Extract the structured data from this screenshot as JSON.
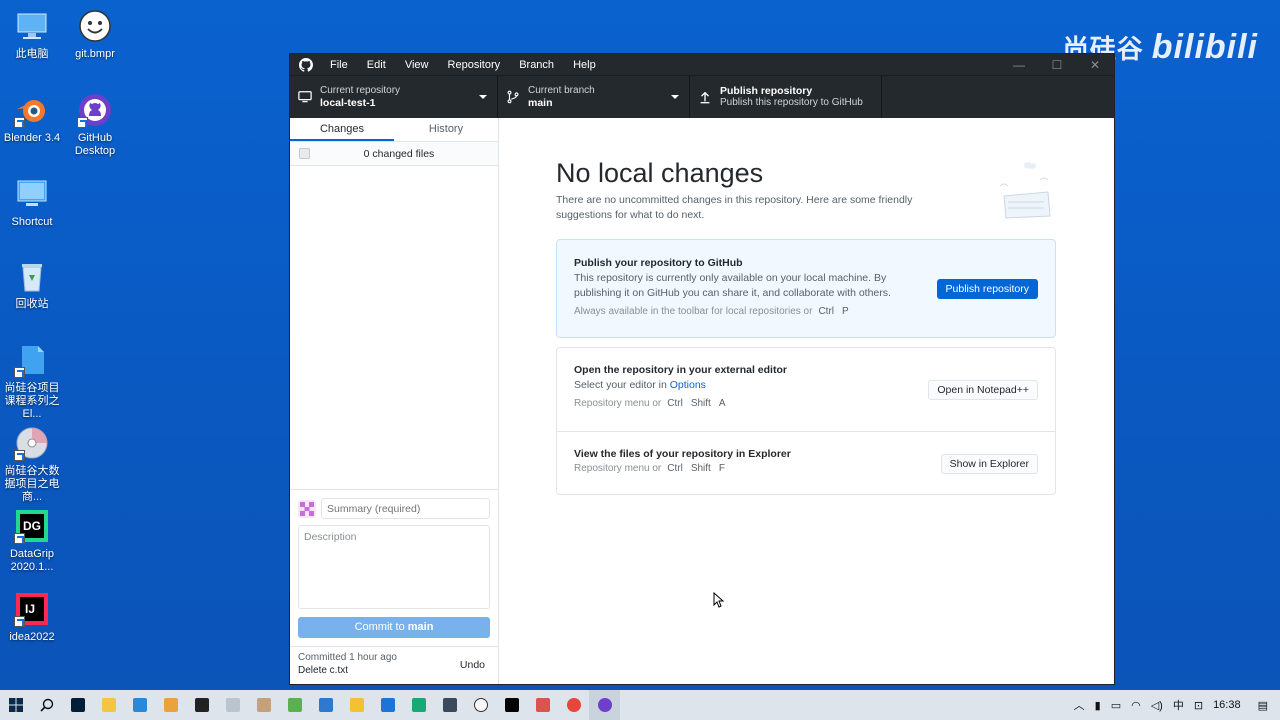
{
  "desktop": {
    "icons": [
      {
        "label": "此电脑"
      },
      {
        "label": "git.bmpr"
      },
      {
        "label": "Blender 3.4"
      },
      {
        "label": "GitHub Desktop"
      },
      {
        "label": "Shortcut"
      },
      {
        "label": "回收站"
      },
      {
        "label": "尚硅谷项目课程系列之El..."
      },
      {
        "label": "尚硅谷大数据项目之电商..."
      },
      {
        "label": "DataGrip 2020.1..."
      },
      {
        "label": "idea2022"
      }
    ],
    "watermark": {
      "brand": "尚硅谷",
      "site": "bilibili"
    }
  },
  "window": {
    "menu": [
      "File",
      "Edit",
      "View",
      "Repository",
      "Branch",
      "Help"
    ],
    "controls": {
      "minimize": "—",
      "maximize": "☐",
      "close": "✕"
    }
  },
  "toolbar": {
    "repo": {
      "label": "Current repository",
      "value": "local-test-1"
    },
    "branch": {
      "label": "Current branch",
      "value": "main"
    },
    "publish": {
      "label": "Publish repository",
      "sub": "Publish this repository to GitHub"
    }
  },
  "sidebar": {
    "tabs": [
      "Changes",
      "History"
    ],
    "changed_files": "0 changed files",
    "summary_placeholder": "Summary (required)",
    "description_placeholder": "Description",
    "commit_prefix": "Commit to ",
    "commit_branch": "main",
    "last_commit": {
      "time": "Committed 1 hour ago",
      "message": "Delete c.txt",
      "undo": "Undo"
    }
  },
  "main": {
    "title": "No local changes",
    "description": "There are no uncommitted changes in this repository. Here are some friendly suggestions for what to do next.",
    "publish_card": {
      "title": "Publish your repository to GitHub",
      "description": "This repository is currently only available on your local machine. By publishing it on GitHub you can share it, and collaborate with others.",
      "hint": "Always available in the toolbar for local repositories or",
      "keys": [
        "Ctrl",
        "P"
      ],
      "button": "Publish repository"
    },
    "editor_card": {
      "title": "Open the repository in your external editor",
      "desc_prefix": "Select your editor in ",
      "desc_link": "Options",
      "hint": "Repository menu or",
      "keys": [
        "Ctrl",
        "Shift",
        "A"
      ],
      "button": "Open in Notepad++"
    },
    "explorer_card": {
      "title": "View the files of your repository in Explorer",
      "hint": "Repository menu or",
      "keys": [
        "Ctrl",
        "Shift",
        "F"
      ],
      "button": "Show in Explorer"
    }
  },
  "taskbar": {
    "tray": {
      "ime": "中",
      "time": "16:38"
    }
  },
  "colors": {
    "accent": "#0366d6",
    "toolbar": "#24292e",
    "desktop": "#0a5bc4"
  }
}
